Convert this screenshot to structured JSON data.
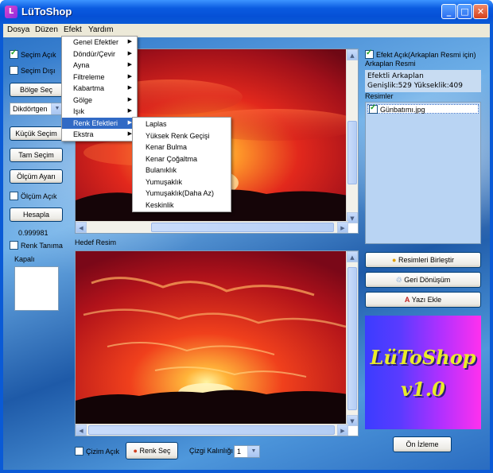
{
  "window": {
    "title": "LüToShop",
    "minimize_glyph": "_",
    "maximize_glyph": "□",
    "close_glyph": "✕"
  },
  "menu": {
    "dosya": "Dosya",
    "duzen": "Düzen",
    "efekt": "Efekt",
    "yardim": "Yardım"
  },
  "left": {
    "secim_acik": "Seçim Açık",
    "secim_disi": "Seçim Dışı",
    "bolge_sec": "Bölge Seç",
    "shape_select": "Dikdörtgen",
    "kucuk_secim": "Küçük Seçim",
    "tam_secim": "Tam Seçim",
    "olcum_ayari": "Ölçüm Ayarı",
    "olcum_acik": "Ölçüm Açık",
    "hesapla": "Hesapla",
    "value": "0.999981",
    "renk_tanima": "Renk Tanıma",
    "kapali": "Kapalı"
  },
  "efekt_menu": {
    "items": [
      {
        "label": "Genel Efektler"
      },
      {
        "label": "Döndür/Çevir"
      },
      {
        "label": "Ayna"
      },
      {
        "label": "Filtreleme"
      },
      {
        "label": "Kabartma"
      },
      {
        "label": "Gölge"
      },
      {
        "label": "Işık"
      },
      {
        "label": "Renk Efektleri"
      },
      {
        "label": "Ekstra"
      }
    ],
    "selected": "Renk Efektleri",
    "submenu_glyph": "▶"
  },
  "renk_submenu": {
    "items": [
      "Laplas",
      "Yüksek Renk Geçişi",
      "Kenar Bulma",
      "Kenar Çoğaltma",
      "Bulanıklık",
      "Yumuşaklık",
      "Yumuşaklık(Daha Az)",
      "Keskinlik"
    ]
  },
  "center": {
    "hedef_resim": "Hedef Resim",
    "cizim_acik": "Çizim Açık",
    "renk_sec": "Renk Seç",
    "cizgi_kalinligi": "Çizgi Kalınlığı",
    "cizgi_value": "1"
  },
  "right": {
    "efekt_acik": "Efekt Açık(Arkaplan Resmi için)",
    "arkaplan_resmi": "Arkaplan Resmi",
    "efektli_arkaplan": "Efektli Arkaplan",
    "size_info": "Genişlik:529 Yükseklik:409",
    "resimler": "Resimler",
    "image_file": "Günbatımı.jpg",
    "birlestir": "Resimleri Birleştir",
    "geri_donusum": "Geri Dönüşüm",
    "yazi_ekle": "Yazı Ekle",
    "logo_line1": "LüToShop",
    "logo_line2": "v1.0",
    "on_izleme": "Ön İzleme"
  },
  "colors": {
    "title_bar": "#0a5ad6",
    "menu_highlight": "#316ac5",
    "logo_text": "#e8ec2a"
  }
}
